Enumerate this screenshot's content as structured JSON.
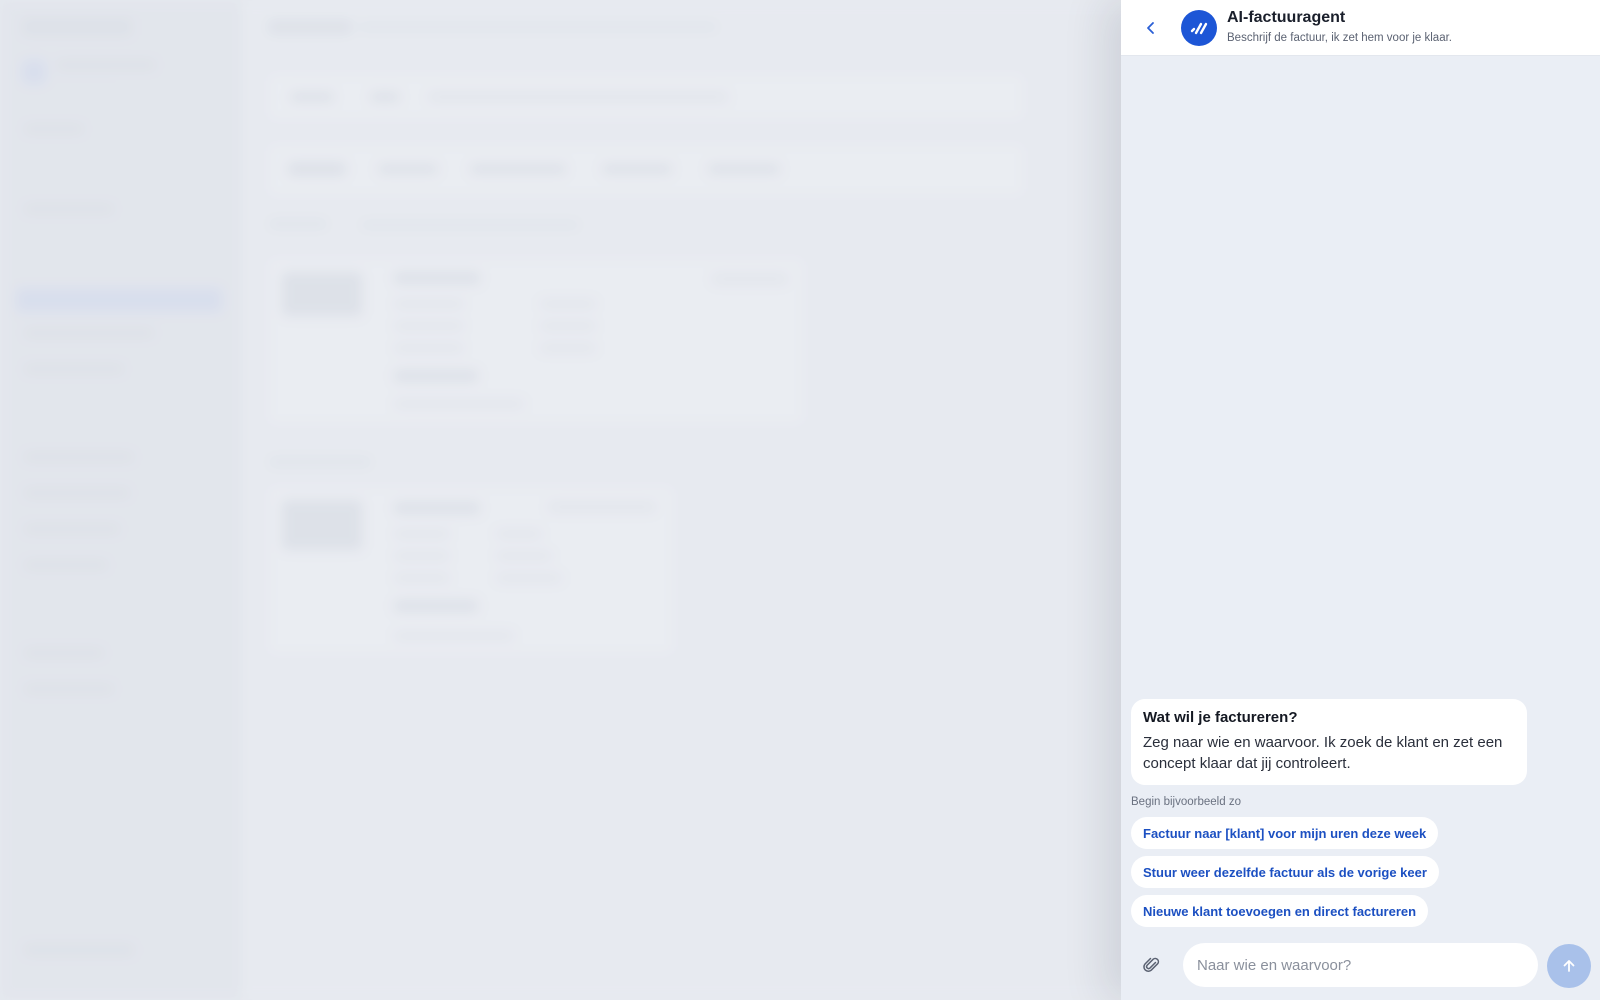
{
  "agent": {
    "title": "AI-factuuragent",
    "subtitle": "Beschrijf de factuur, ik zet hem voor je klaar.",
    "back_icon": "chevron-left-icon",
    "avatar_icon": "agent-logo-icon"
  },
  "message": {
    "title": "Wat wil je factureren?",
    "text": "Zeg naar wie en waarvoor. Ik zoek de klant en zet een concept klaar dat jij controleert."
  },
  "examples": {
    "label": "Begin bijvoorbeeld zo",
    "items": [
      "Factuur naar [klant] voor mijn uren deze week",
      "Stuur weer dezelfde factuur als de vorige keer",
      "Nieuwe klant toevoegen en direct factureren"
    ]
  },
  "composer": {
    "placeholder": "Naar wie en waarvoor?",
    "value": "",
    "attach_icon": "paperclip-icon",
    "send_icon": "arrow-up-icon"
  },
  "colors": {
    "accent": "#1d56d6",
    "chip_text": "#1c50c2",
    "send_disabled": "#a9c1ea",
    "drawer_bg": "#eaeef5"
  }
}
